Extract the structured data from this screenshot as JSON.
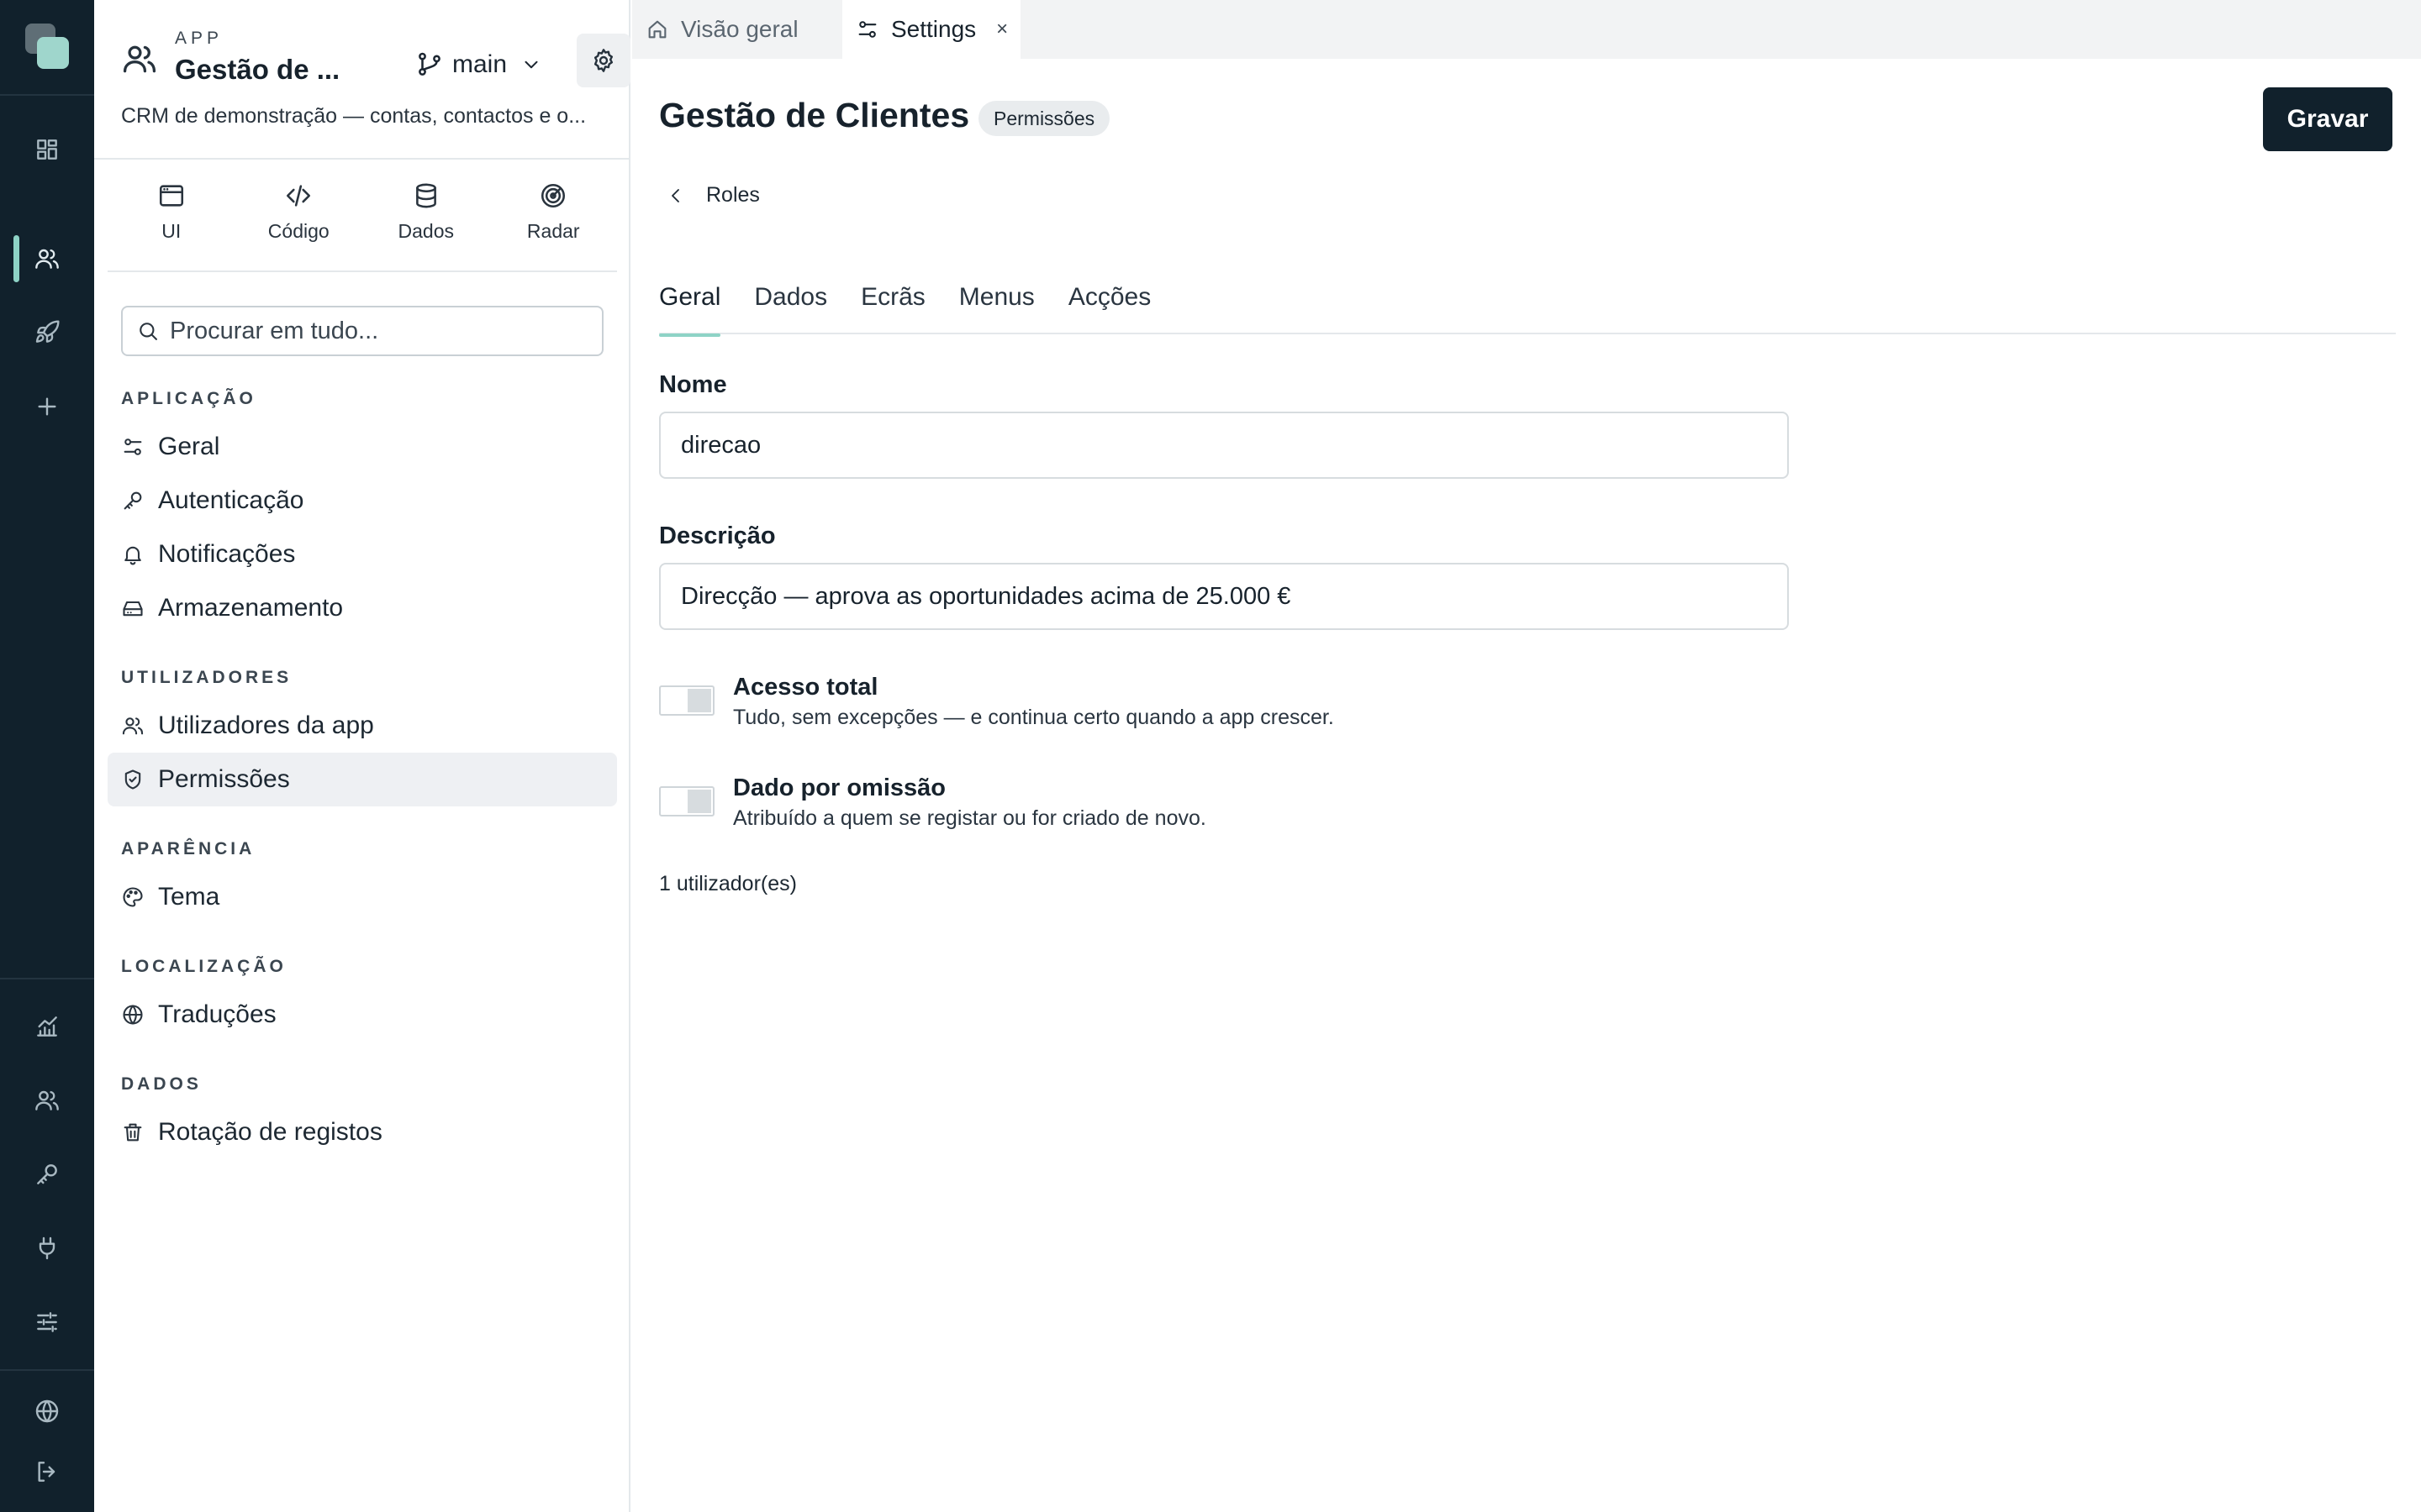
{
  "app": {
    "kicker": "APP",
    "name": "Gestão de ...",
    "branch": "main",
    "description": "CRM de demonstração — contas, contactos e o..."
  },
  "tools": [
    {
      "label": "UI",
      "icon": "browser-window-icon"
    },
    {
      "label": "Código",
      "icon": "code-icon"
    },
    {
      "label": "Dados",
      "icon": "database-icon"
    },
    {
      "label": "Radar",
      "icon": "radar-icon"
    }
  ],
  "search": {
    "placeholder": "Procurar em tudo..."
  },
  "nav": {
    "sections": [
      {
        "title": "APLICAÇÃO",
        "items": [
          "Geral",
          "Autenticação",
          "Notificações",
          "Armazenamento"
        ]
      },
      {
        "title": "UTILIZADORES",
        "items": [
          "Utilizadores da app",
          "Permissões"
        ]
      },
      {
        "title": "APARÊNCIA",
        "items": [
          "Tema"
        ]
      },
      {
        "title": "LOCALIZAÇÃO",
        "items": [
          "Traduções"
        ]
      },
      {
        "title": "DADOS",
        "items": [
          "Rotação de registos"
        ]
      }
    ],
    "active_item": "Permissões"
  },
  "file_tabs": [
    {
      "label": "Visão geral",
      "icon": "home-icon",
      "active": false
    },
    {
      "label": "Settings",
      "icon": "sliders-icon",
      "active": true,
      "close": "×"
    }
  ],
  "page": {
    "title": "Gestão de Clientes",
    "badge": "Permissões",
    "save_label": "Gravar",
    "back_label": "Roles"
  },
  "role_tabs": [
    "Geral",
    "Dados",
    "Ecrãs",
    "Menus",
    "Acções"
  ],
  "active_role_tab": "Geral",
  "form": {
    "name_label": "Nome",
    "name_value": "direcao",
    "description_label": "Descrição",
    "description_value": "Direcção — aprova as oportunidades acima de 25.000 €",
    "full_access": {
      "title": "Acesso total",
      "description": "Tudo, sem excepções — e continua certo quando a app crescer.",
      "enabled": false
    },
    "default_role": {
      "title": "Dado por omissão",
      "description": "Atribuído a quem se registar ou for criado de novo.",
      "enabled": false
    },
    "user_count": "1 utilizador(es)"
  },
  "colors": {
    "rail_bg": "#11212c",
    "accent": "#8ed3c6",
    "primary_button": "#11212c"
  }
}
